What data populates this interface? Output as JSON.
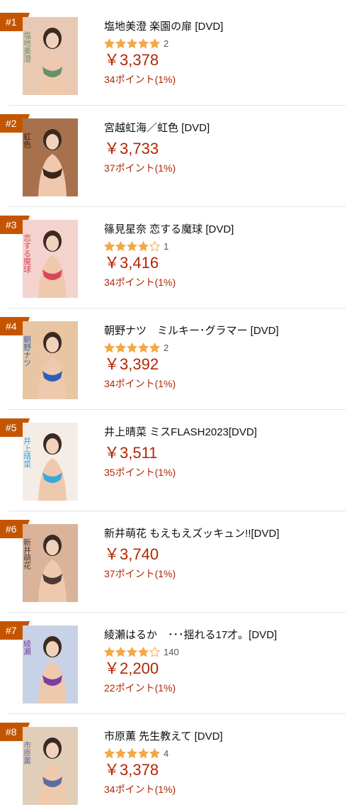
{
  "colors": {
    "badge": "#c45500",
    "price": "#b12704",
    "star": "#f3a847",
    "divider": "#e3e3e3"
  },
  "items": [
    {
      "rank": "#1",
      "title": "塩地美澄 楽園の扉 [DVD]",
      "stars": 5,
      "rating_count": "2",
      "price": "￥3,378",
      "points": "34ポイント(1%)",
      "cover_tint": "#e9c9b4",
      "cover_accent": "#6b8f6a",
      "cover_label_text": "塩地美澄"
    },
    {
      "rank": "#2",
      "title": "宮越虹海／虹色 [DVD]",
      "stars": null,
      "rating_count": "",
      "price": "￥3,733",
      "points": "37ポイント(1%)",
      "cover_tint": "#a8714d",
      "cover_accent": "#3b2418",
      "cover_label_text": "虹色"
    },
    {
      "rank": "#3",
      "title": "篠見星奈 恋する魔球 [DVD]",
      "stars": 4,
      "rating_count": "1",
      "price": "￥3,416",
      "points": "34ポイント(1%)",
      "cover_tint": "#f4d3cf",
      "cover_accent": "#d9485a",
      "cover_label_text": "恋する魔球"
    },
    {
      "rank": "#4",
      "title": "朝野ナツ　ミルキー･グラマー [DVD]",
      "stars": 5,
      "rating_count": "2",
      "price": "￥3,392",
      "points": "34ポイント(1%)",
      "cover_tint": "#e8c6a3",
      "cover_accent": "#2d5fb8",
      "cover_label_text": "朝野ナツ"
    },
    {
      "rank": "#5",
      "title": "井上晴菜 ミスFLASH2023[DVD]",
      "stars": null,
      "rating_count": "",
      "price": "￥3,511",
      "points": "35ポイント(1%)",
      "cover_tint": "#f6ece6",
      "cover_accent": "#3aa8d8",
      "cover_label_text": "井上晴菜"
    },
    {
      "rank": "#6",
      "title": "新井萌花 もえもえズッキュン!![DVD]",
      "stars": null,
      "rating_count": "",
      "price": "￥3,740",
      "points": "37ポイント(1%)",
      "cover_tint": "#d9b39a",
      "cover_accent": "#4a3a32",
      "cover_label_text": "新井萌花"
    },
    {
      "rank": "#7",
      "title": "綾瀬はるか　･･･揺れる17才。[DVD]",
      "stars": 4,
      "rating_count": "140",
      "price": "￥2,200",
      "points": "22ポイント(1%)",
      "cover_tint": "#c8d2e6",
      "cover_accent": "#7a3fa0",
      "cover_label_text": "綾瀬"
    },
    {
      "rank": "#8",
      "title": "市原薫 先生教えて [DVD]",
      "stars": 5,
      "rating_count": "4",
      "price": "￥3,378",
      "points": "34ポイント(1%)",
      "cover_tint": "#e2cdb9",
      "cover_accent": "#5a6fa0",
      "cover_label_text": "市原薫"
    }
  ]
}
